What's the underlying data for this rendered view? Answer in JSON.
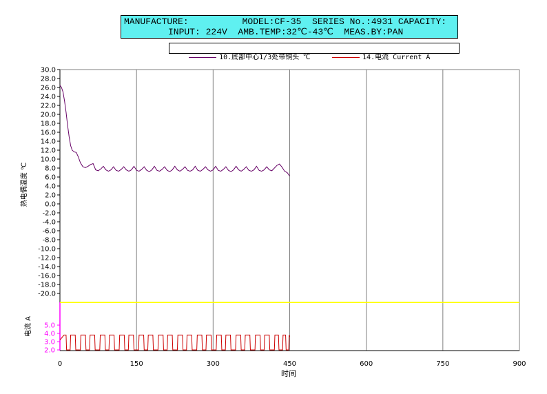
{
  "header": {
    "line1": "MANUFACTURE:          MODEL:CF-35  SERIES No.:4931 CAPACITY:",
    "line2": "INPUT: 224V  AMB.TEMP:32℃-43℃  MEAS.BY:PAN"
  },
  "legend": {
    "entries": [
      {
        "label": "10.底部中心1/3处带铜头 ℃",
        "color": "#660066"
      },
      {
        "label": "14.电流 Current A",
        "color": "#cc0000"
      }
    ]
  },
  "chart_data": [
    {
      "type": "line",
      "ylabel": "热电偶温度 ℃",
      "xlabel": "时间",
      "xlim": [
        0,
        900
      ],
      "ylim": [
        -22,
        30
      ],
      "x_ticks": [
        "0",
        "150",
        "300",
        "450",
        "600",
        "750",
        "900"
      ],
      "y_ticks": [
        "30.0",
        "28.0",
        "26.0",
        "24.0",
        "22.0",
        "20.0",
        "18.0",
        "16.0",
        "14.0",
        "12.0",
        "10.0",
        "8.0",
        "6.0",
        "4.0",
        "2.0",
        "0.0",
        "-2.0",
        "-4.0",
        "-6.0",
        "-8.0",
        "-10.0",
        "-12.0",
        "-14.0",
        "-16.0",
        "-18.0",
        "-20.0"
      ],
      "grid": true,
      "series": [
        {
          "name": "10.底部中心1/3处带铜头 ℃",
          "color": "#660066",
          "x": [
            0,
            3,
            6,
            9,
            12,
            15,
            18,
            21,
            24,
            28,
            32,
            36,
            40,
            45,
            50,
            55,
            60,
            65,
            70,
            75,
            80,
            85,
            90,
            95,
            100,
            105,
            110,
            115,
            120,
            125,
            130,
            135,
            140,
            145,
            150,
            155,
            160,
            165,
            170,
            175,
            180,
            185,
            190,
            195,
            200,
            205,
            210,
            215,
            220,
            225,
            230,
            235,
            240,
            245,
            250,
            255,
            260,
            265,
            270,
            275,
            280,
            285,
            290,
            295,
            300,
            305,
            310,
            315,
            320,
            325,
            330,
            335,
            340,
            345,
            350,
            355,
            360,
            365,
            370,
            375,
            380,
            385,
            390,
            395,
            400,
            405,
            410,
            415,
            420,
            425,
            430,
            435,
            440,
            445,
            450
          ],
          "y": [
            26.5,
            26.0,
            25.0,
            23.0,
            20.5,
            17.5,
            15.0,
            13.0,
            12.0,
            11.6,
            11.5,
            10.5,
            9.2,
            8.3,
            8.1,
            8.4,
            8.8,
            9.0,
            7.6,
            7.4,
            7.8,
            8.4,
            7.6,
            7.3,
            7.6,
            8.3,
            7.5,
            7.3,
            7.7,
            8.3,
            7.6,
            7.3,
            7.6,
            8.4,
            7.5,
            7.3,
            7.7,
            8.3,
            7.5,
            7.2,
            7.6,
            8.4,
            7.5,
            7.3,
            7.7,
            8.3,
            7.5,
            7.2,
            7.6,
            8.4,
            7.6,
            7.3,
            7.7,
            8.3,
            7.5,
            7.3,
            7.6,
            8.4,
            7.5,
            7.3,
            7.7,
            8.3,
            7.6,
            7.3,
            7.6,
            8.4,
            7.5,
            7.3,
            7.7,
            8.3,
            7.5,
            7.2,
            7.6,
            8.4,
            7.6,
            7.3,
            7.7,
            8.3,
            7.5,
            7.3,
            7.6,
            8.4,
            7.5,
            7.3,
            7.6,
            8.3,
            7.6,
            7.4,
            8.0,
            8.6,
            8.9,
            8.2,
            7.3,
            7.0,
            6.2
          ]
        }
      ]
    },
    {
      "type": "line",
      "ylabel": "电流 A",
      "xlim": [
        0,
        900
      ],
      "ylim": [
        2.0,
        6.0
      ],
      "y_ticks": [
        "5.0",
        "4.0",
        "3.0",
        "2.0"
      ],
      "series": [
        {
          "name": "14.电流 Current A",
          "color": "#cc0000",
          "x": [
            0,
            4,
            8,
            12,
            13,
            20,
            21,
            30,
            31,
            40,
            41,
            50,
            51,
            58,
            59,
            68,
            69,
            78,
            79,
            88,
            89,
            96,
            97,
            106,
            107,
            116,
            117,
            126,
            127,
            134,
            135,
            144,
            145,
            154,
            155,
            164,
            165,
            172,
            173,
            182,
            183,
            192,
            193,
            202,
            203,
            210,
            211,
            220,
            221,
            230,
            231,
            240,
            241,
            248,
            249,
            258,
            259,
            268,
            269,
            278,
            279,
            286,
            287,
            296,
            297,
            306,
            307,
            316,
            317,
            324,
            325,
            334,
            335,
            344,
            345,
            354,
            355,
            362,
            363,
            372,
            373,
            382,
            383,
            392,
            393,
            400,
            401,
            410,
            411,
            420,
            421,
            428,
            429,
            436,
            437,
            442,
            443,
            448,
            449,
            450
          ],
          "y": [
            3.2,
            3.5,
            3.8,
            3.8,
            2.0,
            2.0,
            3.8,
            3.8,
            2.0,
            2.0,
            3.8,
            3.8,
            2.0,
            2.0,
            3.8,
            3.8,
            2.0,
            2.0,
            3.8,
            3.8,
            2.0,
            2.0,
            3.8,
            3.8,
            2.0,
            2.0,
            3.8,
            3.8,
            2.0,
            2.0,
            3.8,
            3.8,
            2.0,
            2.0,
            3.8,
            3.8,
            2.0,
            2.0,
            3.8,
            3.8,
            2.0,
            2.0,
            3.8,
            3.8,
            2.0,
            2.0,
            3.8,
            3.8,
            2.0,
            2.0,
            3.8,
            3.8,
            2.0,
            2.0,
            3.8,
            3.8,
            2.0,
            2.0,
            3.8,
            3.8,
            2.0,
            2.0,
            3.8,
            3.8,
            2.0,
            2.0,
            3.8,
            3.8,
            2.0,
            2.0,
            3.8,
            3.8,
            2.0,
            2.0,
            3.8,
            3.8,
            2.0,
            2.0,
            3.8,
            3.8,
            2.0,
            2.0,
            3.8,
            3.8,
            2.0,
            2.0,
            3.8,
            3.8,
            2.0,
            2.0,
            3.8,
            3.8,
            2.0,
            2.0,
            3.8,
            3.8,
            2.0,
            2.0,
            3.8,
            3.6
          ]
        }
      ]
    }
  ],
  "colors": {
    "header_bg": "#5ff0f0",
    "divider": "#ffff00",
    "current_axis": "#ff00ff",
    "grid": "#808080"
  }
}
